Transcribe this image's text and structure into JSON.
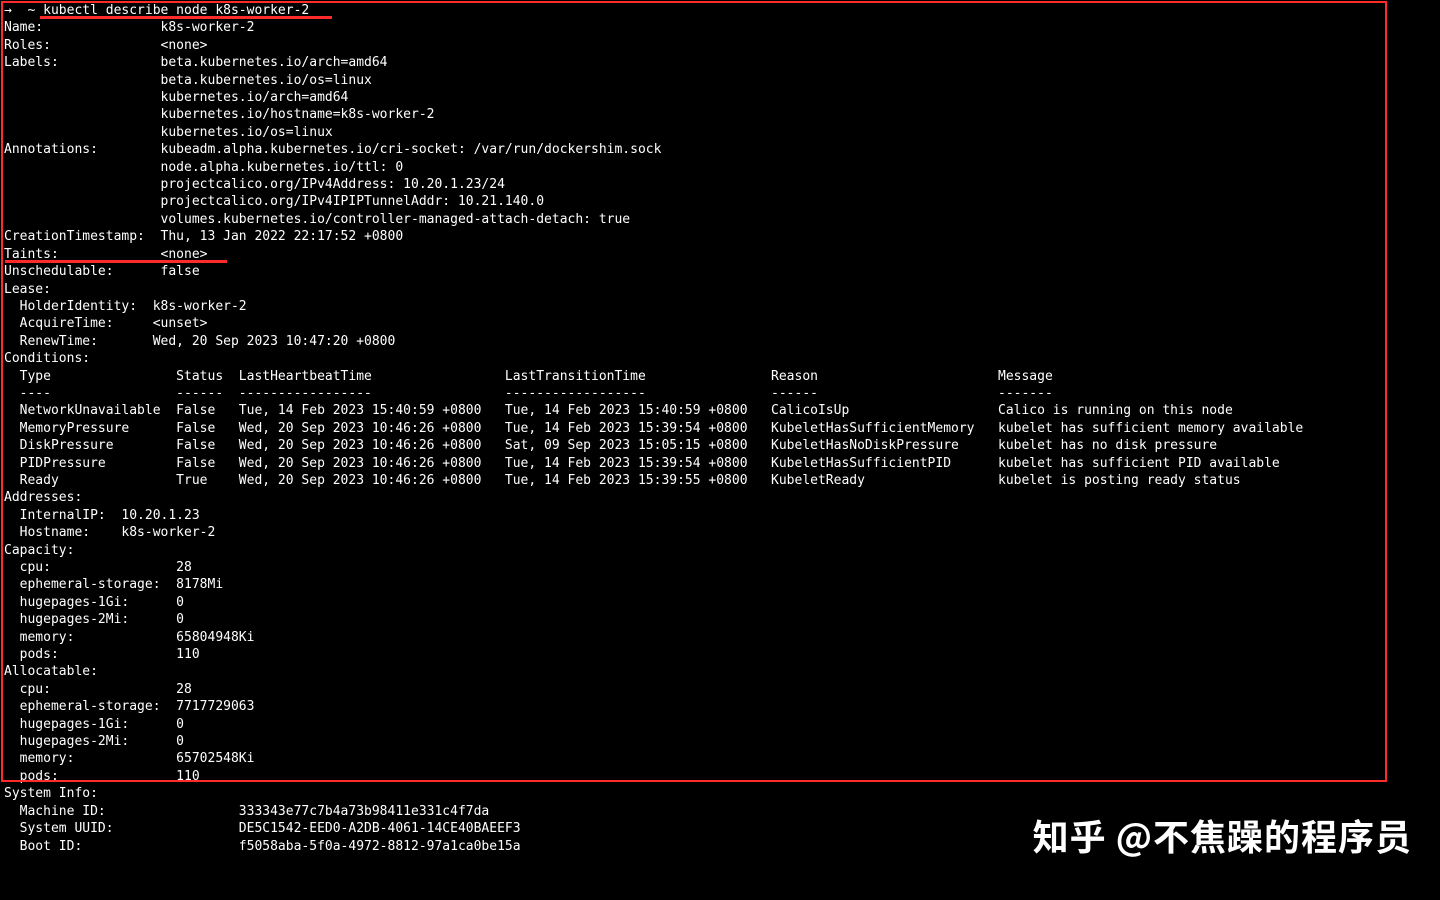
{
  "prompt": {
    "arrow": "→",
    "tilde": "~",
    "cmd": "kubectl describe node k8s-worker-2"
  },
  "top_fields": [
    [
      "Name:",
      "k8s-worker-2"
    ],
    [
      "Roles:",
      "<none>"
    ],
    [
      "Labels:",
      "beta.kubernetes.io/arch=amd64"
    ],
    [
      "",
      "beta.kubernetes.io/os=linux"
    ],
    [
      "",
      "kubernetes.io/arch=amd64"
    ],
    [
      "",
      "kubernetes.io/hostname=k8s-worker-2"
    ],
    [
      "",
      "kubernetes.io/os=linux"
    ],
    [
      "Annotations:",
      "kubeadm.alpha.kubernetes.io/cri-socket: /var/run/dockershim.sock"
    ],
    [
      "",
      "node.alpha.kubernetes.io/ttl: 0"
    ],
    [
      "",
      "projectcalico.org/IPv4Address: 10.20.1.23/24"
    ],
    [
      "",
      "projectcalico.org/IPv4IPIPTunnelAddr: 10.21.140.0"
    ],
    [
      "",
      "volumes.kubernetes.io/controller-managed-attach-detach: true"
    ],
    [
      "CreationTimestamp:",
      "Thu, 13 Jan 2022 22:17:52 +0800"
    ],
    [
      "Taints:",
      "<none>"
    ],
    [
      "Unschedulable:",
      "false"
    ],
    [
      "Lease:",
      ""
    ]
  ],
  "lease_fields": [
    [
      "HolderIdentity:",
      "k8s-worker-2"
    ],
    [
      "AcquireTime:",
      "<unset>"
    ],
    [
      "RenewTime:",
      "Wed, 20 Sep 2023 10:47:20 +0800"
    ]
  ],
  "conditions_label": "Conditions:",
  "conditions_header": [
    "Type",
    "Status",
    "LastHeartbeatTime",
    "LastTransitionTime",
    "Reason",
    "Message"
  ],
  "conditions_dashes": [
    "----",
    "------",
    "-----------------",
    "------------------",
    "------",
    "-------"
  ],
  "conditions_rows": [
    [
      "NetworkUnavailable",
      "False",
      "Tue, 14 Feb 2023 15:40:59 +0800",
      "Tue, 14 Feb 2023 15:40:59 +0800",
      "CalicoIsUp",
      "Calico is running on this node"
    ],
    [
      "MemoryPressure",
      "False",
      "Wed, 20 Sep 2023 10:46:26 +0800",
      "Tue, 14 Feb 2023 15:39:54 +0800",
      "KubeletHasSufficientMemory",
      "kubelet has sufficient memory available"
    ],
    [
      "DiskPressure",
      "False",
      "Wed, 20 Sep 2023 10:46:26 +0800",
      "Sat, 09 Sep 2023 15:05:15 +0800",
      "KubeletHasNoDiskPressure",
      "kubelet has no disk pressure"
    ],
    [
      "PIDPressure",
      "False",
      "Wed, 20 Sep 2023 10:46:26 +0800",
      "Tue, 14 Feb 2023 15:39:54 +0800",
      "KubeletHasSufficientPID",
      "kubelet has sufficient PID available"
    ],
    [
      "Ready",
      "True",
      "Wed, 20 Sep 2023 10:46:26 +0800",
      "Tue, 14 Feb 2023 15:39:55 +0800",
      "KubeletReady",
      "kubelet is posting ready status"
    ]
  ],
  "addresses_label": "Addresses:",
  "addresses": [
    [
      "InternalIP:",
      "10.20.1.23"
    ],
    [
      "Hostname:",
      "k8s-worker-2"
    ]
  ],
  "capacity_label": "Capacity:",
  "capacity": [
    [
      "cpu:",
      "28"
    ],
    [
      "ephemeral-storage:",
      "8178Mi"
    ],
    [
      "hugepages-1Gi:",
      "0"
    ],
    [
      "hugepages-2Mi:",
      "0"
    ],
    [
      "memory:",
      "65804948Ki"
    ],
    [
      "pods:",
      "110"
    ]
  ],
  "allocatable_label": "Allocatable:",
  "allocatable": [
    [
      "cpu:",
      "28"
    ],
    [
      "ephemeral-storage:",
      "7717729063"
    ],
    [
      "hugepages-1Gi:",
      "0"
    ],
    [
      "hugepages-2Mi:",
      "0"
    ],
    [
      "memory:",
      "65702548Ki"
    ],
    [
      "pods:",
      "110"
    ]
  ],
  "sysinfo_label": "System Info:",
  "sysinfo": [
    [
      "Machine ID:",
      "333343e77c7b4a73b98411e331c4f7da"
    ],
    [
      "System UUID:",
      "DE5C1542-EED0-A2DB-4061-14CE40BAEEF3"
    ],
    [
      "Boot ID:",
      "f5058aba-5f0a-4972-8812-97a1ca0be15a"
    ]
  ],
  "cond_widths": [
    20,
    8,
    34,
    34,
    29,
    0
  ],
  "watermark": "知乎 @不焦躁的程序员"
}
